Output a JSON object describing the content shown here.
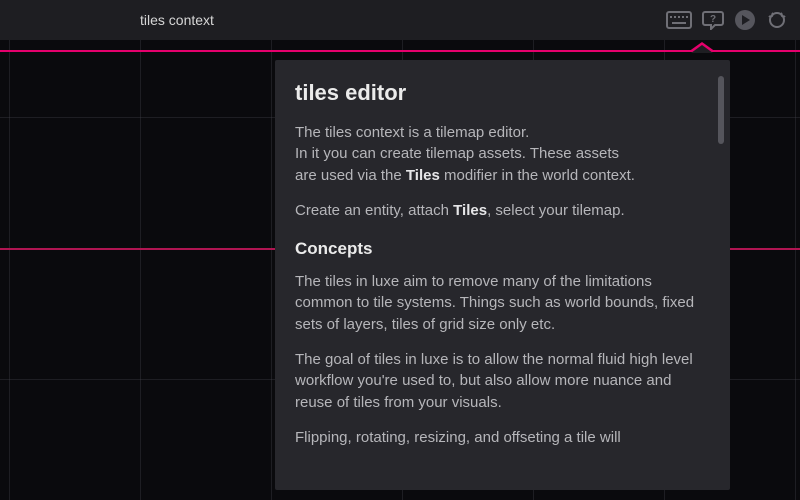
{
  "topbar": {
    "context_label": "tiles context",
    "icons": [
      "keyboard",
      "help",
      "play",
      "luxe-logo"
    ]
  },
  "colors": {
    "accent": "#e5006c",
    "panel": "#27272c",
    "bg": "#0a0a0d",
    "topbar": "#1e1e22"
  },
  "help": {
    "title": "tiles editor",
    "intro_lines": [
      "The tiles context is a tilemap editor.",
      "In it you can create tilemap assets. These assets",
      "are used via the Tiles modifier in the world context."
    ],
    "intro_bold": "Tiles",
    "create_line_pre": "Create an entity, attach ",
    "create_line_bold": "Tiles",
    "create_line_post": ", select your tilemap.",
    "concepts_header": "Concepts",
    "concepts_p1": "The tiles in luxe aim to remove many of the limitations common to tile systems. Things such as world bounds, fixed sets of layers, tiles of grid size only etc.",
    "concepts_p2": "The goal of tiles in luxe is to allow the normal fluid high level workflow you're used to, but also allow more nuance and reuse of tiles from your visuals.",
    "concepts_p3_partial": "Flipping, rotating, resizing, and offseting a tile will"
  }
}
